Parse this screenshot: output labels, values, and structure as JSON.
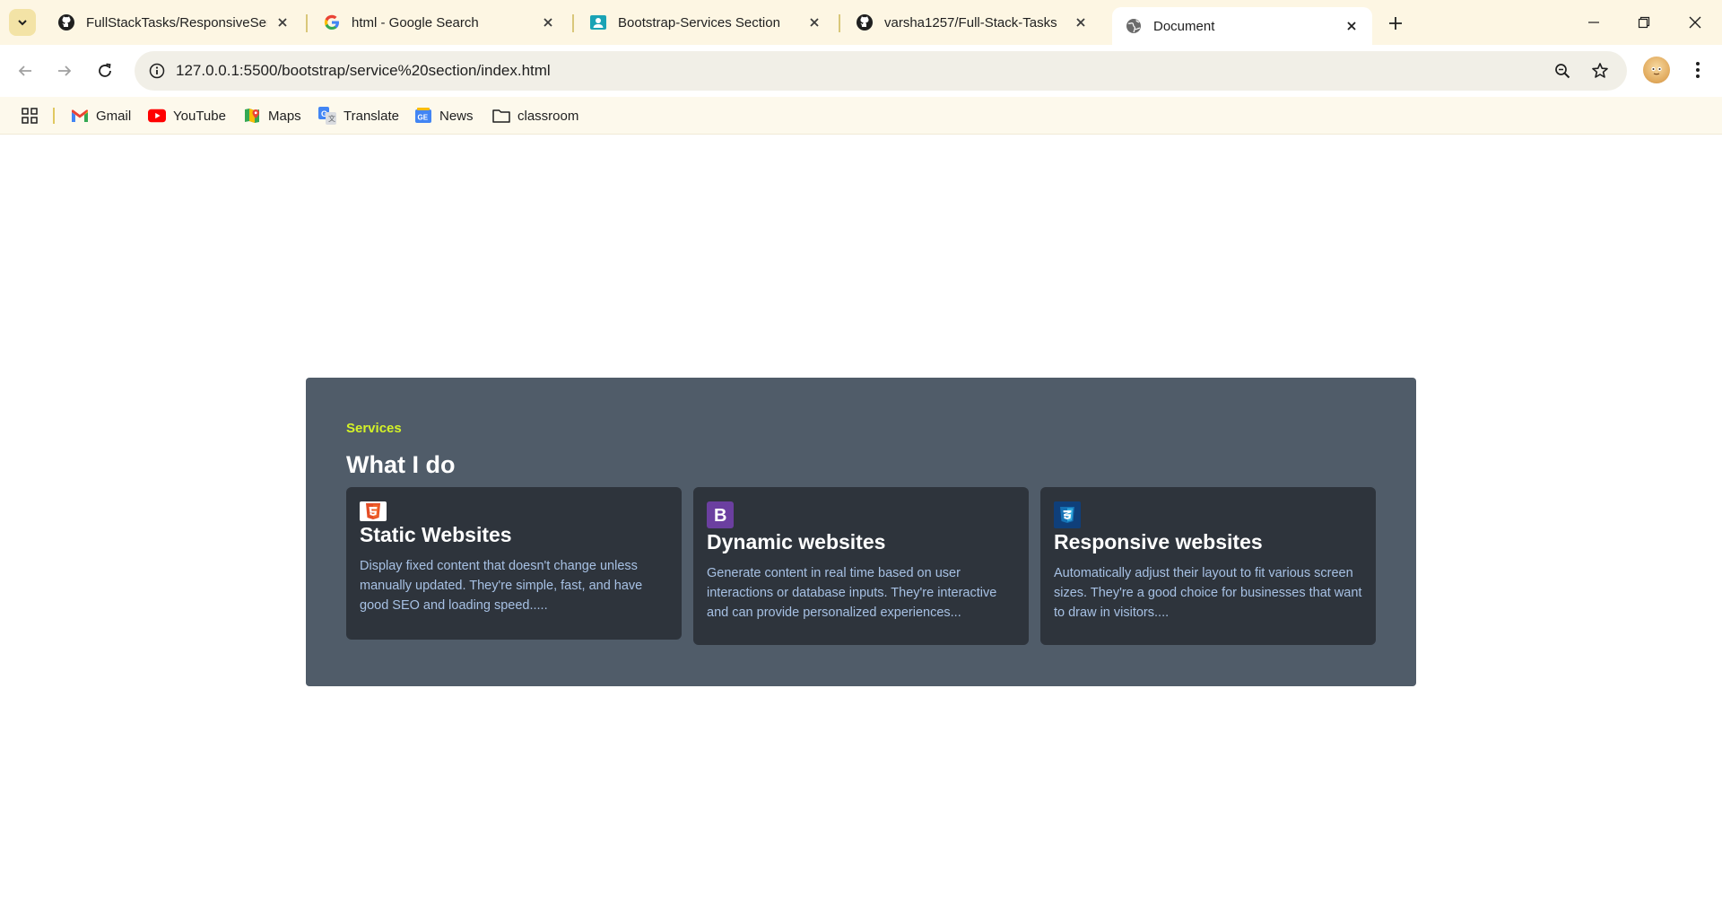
{
  "browser": {
    "tabs": [
      {
        "title": "FullStackTasks/ResponsiveServic",
        "favicon": "github-icon",
        "active": false
      },
      {
        "title": "html - Google Search",
        "favicon": "google-icon",
        "active": false
      },
      {
        "title": "Bootstrap-Services Section",
        "favicon": "person-card-icon",
        "active": false
      },
      {
        "title": "varsha1257/Full-Stack-Tasks",
        "favicon": "github-icon",
        "active": false
      },
      {
        "title": "Document",
        "favicon": "globe-icon",
        "active": true
      }
    ],
    "url": "127.0.0.1:5500/bootstrap/service%20section/index.html",
    "bookmarks": [
      {
        "label": "Gmail",
        "icon": "gmail-icon"
      },
      {
        "label": "YouTube",
        "icon": "youtube-icon"
      },
      {
        "label": "Maps",
        "icon": "maps-icon"
      },
      {
        "label": "Translate",
        "icon": "translate-icon"
      },
      {
        "label": "News",
        "icon": "news-icon"
      },
      {
        "label": "classroom",
        "icon": "folder-icon"
      }
    ]
  },
  "page": {
    "eyebrow": "Services",
    "heading": "What I do",
    "cards": [
      {
        "icon": "html5-icon",
        "title": "Static Websites",
        "text": "Display fixed content that doesn't change unless manually updated. They're simple, fast, and have good SEO and loading speed....."
      },
      {
        "icon": "bootstrap-icon",
        "title": "Dynamic websites",
        "text": "Generate content in real time based on user interactions or database inputs. They're interactive and can provide personalized experiences..."
      },
      {
        "icon": "css3-icon",
        "title": "Responsive websites",
        "text": "Automatically adjust their layout to fit various screen sizes. They're a good choice for businesses that want to draw in visitors...."
      }
    ]
  },
  "colors": {
    "section_bg": "#505c69",
    "card_bg": "#2e343c",
    "eyebrow": "#d4f227",
    "card_text": "#a7c1e4"
  }
}
